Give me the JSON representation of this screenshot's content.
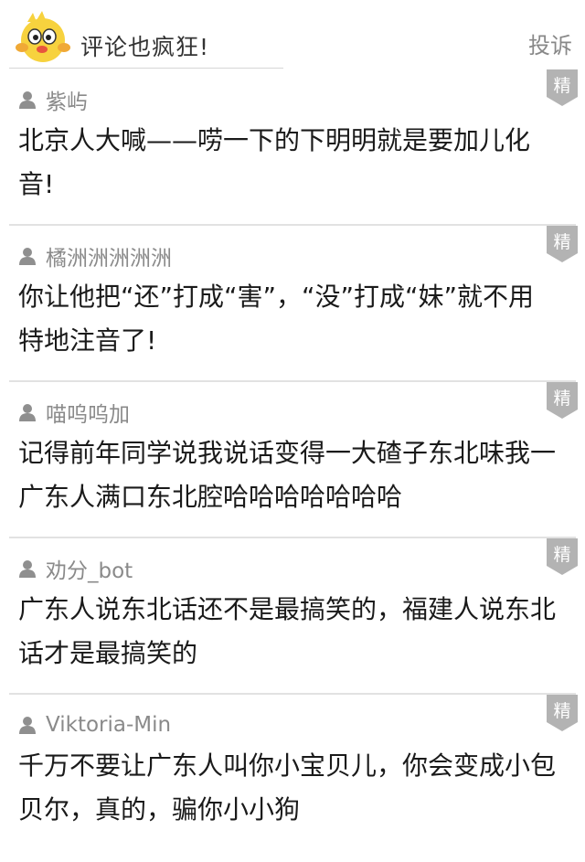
{
  "header": {
    "title": "评论也疯狂!",
    "report_label": "投诉",
    "mascot_icon": "cartoon-chick-mascot-icon"
  },
  "colors": {
    "badge_bg": "#b3b3b3",
    "username": "#8a8a8a",
    "divider": "#e2e2e2"
  },
  "comments": [
    {
      "username": "紫屿",
      "badge": "精",
      "text": "北京人大喊——唠一下的下明明就是要加儿化音!"
    },
    {
      "username": "橘洲洲洲洲洲",
      "badge": "精",
      "text": "你让他把“还”打成“害”，“没”打成“妹”就不用特地注音了!"
    },
    {
      "username": "喵呜呜加",
      "badge": "精",
      "text": "记得前年同学说我说话变得一大碴子东北味我一广东人满口东北腔哈哈哈哈哈哈哈"
    },
    {
      "username": "劝分_bot",
      "badge": "精",
      "text": "广东人说东北话还不是最搞笑的，福建人说东北话才是最搞笑的"
    },
    {
      "username": "Viktoria-Min",
      "badge": "精",
      "text": "千万不要让广东人叫你小宝贝儿，你会变成小包贝尔，真的，骗你小小狗"
    }
  ]
}
